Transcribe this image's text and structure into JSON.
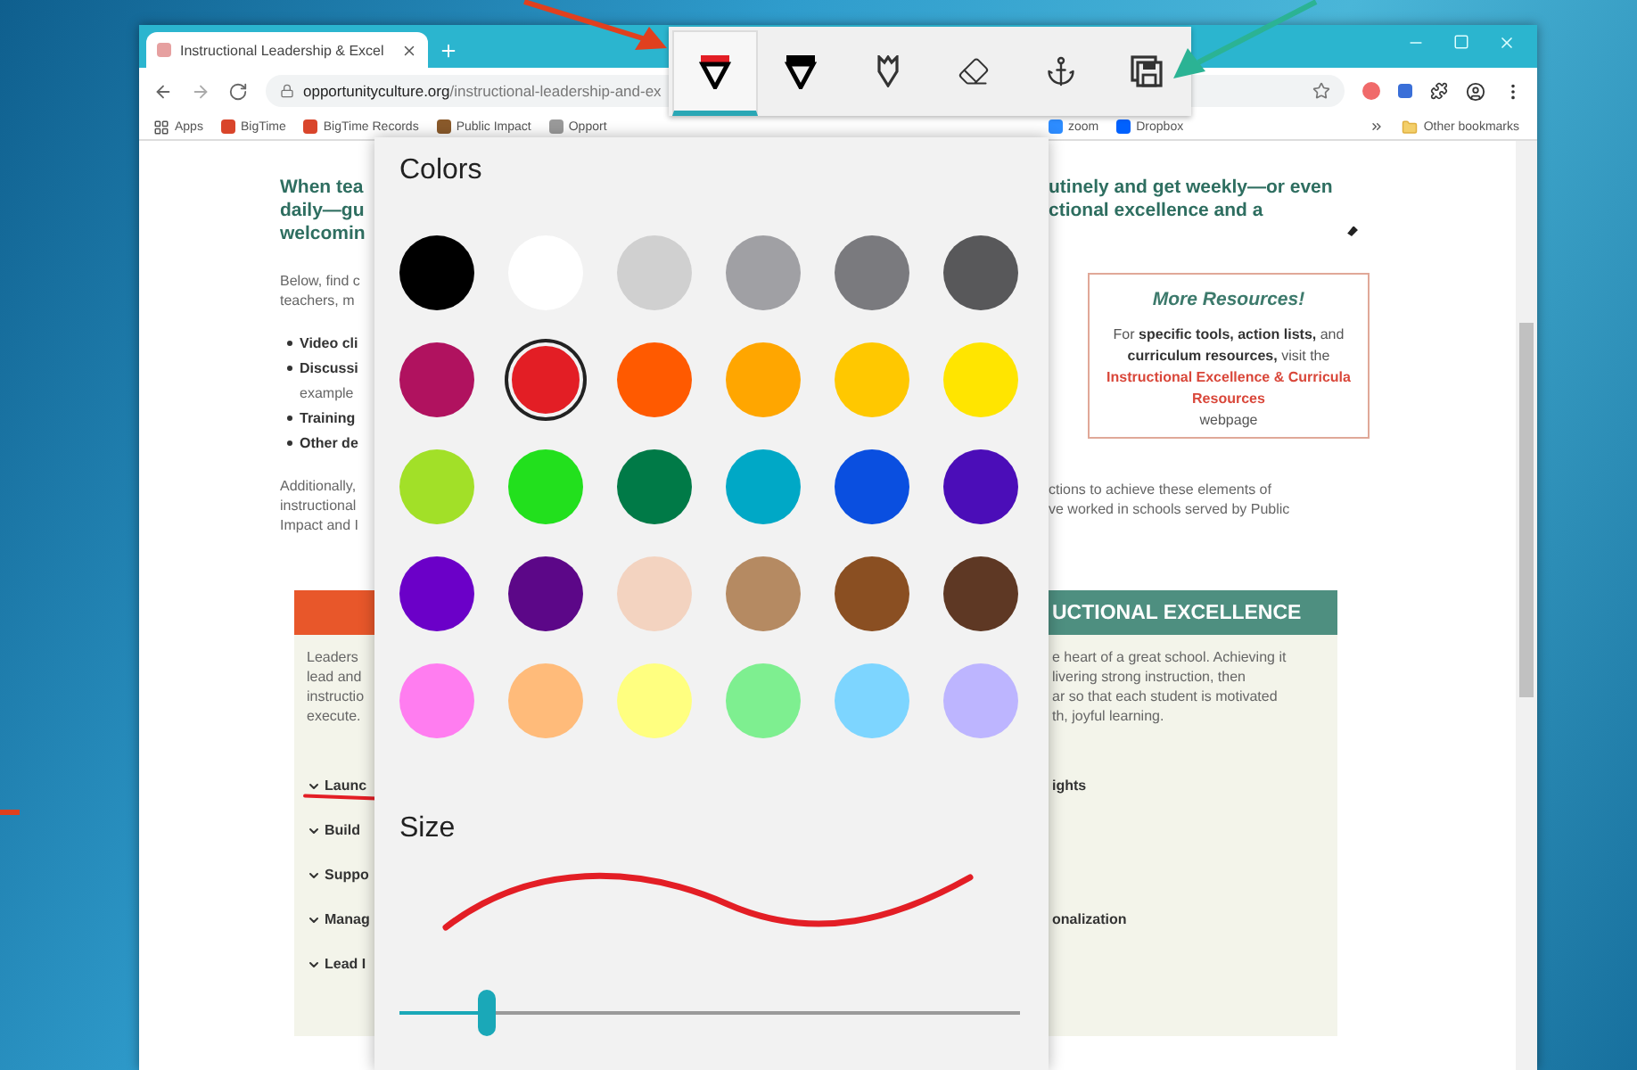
{
  "browser": {
    "tab_title": "Instructional Leadership & Excel",
    "url_domain": "opportunityculture.org",
    "url_path": "/instructional-leadership-and-ex",
    "bookmarks": [
      {
        "kind": "apps",
        "label": "Apps"
      },
      {
        "kind": "site",
        "label": "BigTime",
        "color": "#d9452b"
      },
      {
        "kind": "site",
        "label": "BigTime Records",
        "color": "#d9452b"
      },
      {
        "kind": "site",
        "label": "Public Impact",
        "color": "#8a5a2b"
      },
      {
        "kind": "site",
        "label": "Opport",
        "color": "#9a9a9a"
      }
    ],
    "bookmarks_right": [
      {
        "kind": "site",
        "label": "zoom",
        "color": "#2d8cff"
      },
      {
        "kind": "site",
        "label": "Dropbox",
        "color": "#0061fe"
      }
    ],
    "other_bookmarks": "Other bookmarks"
  },
  "page": {
    "heading_left": [
      "When tea",
      "daily—gu",
      "welcomin"
    ],
    "heading_right": [
      "utinely and get weekly—or even",
      "ctional excellence and a"
    ],
    "intro": [
      "Below, find c",
      "teachers, m"
    ],
    "bullets": [
      {
        "text": "Video cli"
      },
      {
        "text": "Discussi",
        "continuation": "example"
      },
      {
        "text": "Training"
      },
      {
        "text": "Other de"
      }
    ],
    "additional_left": [
      "Additionally,",
      "instructional",
      "Impact and I"
    ],
    "additional_right": [
      "ctions to achieve these elements of",
      "ve worked in schools served by Public"
    ],
    "resources": {
      "title": "More Resources!",
      "text": "For **specific tools, action lists,** and **curriculum resources,** visit the",
      "link": "Instructional Excellence & Curricula Resources",
      "after": "webpage"
    },
    "section": {
      "header": "UCTIONAL EXCELLENCE",
      "body_left": [
        "Leaders",
        "lead and",
        "instructio",
        "execute."
      ],
      "body_right": [
        "e heart of a great school. Achieving it",
        "livering strong instruction, then",
        "ar so that each student is motivated",
        "th, joyful learning."
      ],
      "accordion": [
        {
          "left": "Launc",
          "right": "ights",
          "inked": true
        },
        {
          "left": "Build",
          "inked": false
        },
        {
          "left": "Suppo",
          "inked": false
        },
        {
          "left": "Manag",
          "right": "onalization",
          "inked": false
        },
        {
          "left": "Lead I",
          "inked": false
        }
      ]
    }
  },
  "toolbar": {
    "tools": [
      {
        "kind": "pen",
        "color": "#e31e25",
        "selected": true
      },
      {
        "kind": "pen",
        "color": "#000000",
        "selected": false
      },
      {
        "kind": "pencil",
        "selected": false
      },
      {
        "kind": "eraser",
        "selected": false
      },
      {
        "kind": "anchor",
        "selected": false
      },
      {
        "kind": "save",
        "selected": false
      }
    ]
  },
  "flyout": {
    "title": "Colors",
    "size_label": "Size",
    "size_slider": {
      "level": 0.14
    },
    "colors": [
      {
        "color": "#000000",
        "selected": false
      },
      {
        "color": "#ffffff",
        "selected": false
      },
      {
        "color": "#d0d0d0",
        "selected": false
      },
      {
        "color": "#a0a0a4",
        "selected": false
      },
      {
        "color": "#7a7a7e",
        "selected": false
      },
      {
        "color": "#58585a",
        "selected": false
      },
      {
        "color": "#b0125f",
        "selected": false
      },
      {
        "color": "#e31e25",
        "selected": true
      },
      {
        "color": "#ff5a00",
        "selected": false
      },
      {
        "color": "#ffa600",
        "selected": false
      },
      {
        "color": "#ffc800",
        "selected": false
      },
      {
        "color": "#ffe500",
        "selected": false
      },
      {
        "color": "#a2e028",
        "selected": false
      },
      {
        "color": "#22e01d",
        "selected": false
      },
      {
        "color": "#007a47",
        "selected": false
      },
      {
        "color": "#00a8c6",
        "selected": false
      },
      {
        "color": "#0a4fe0",
        "selected": false
      },
      {
        "color": "#4b0db8",
        "selected": false
      },
      {
        "color": "#6b00c8",
        "selected": false
      },
      {
        "color": "#5c0788",
        "selected": false
      },
      {
        "color": "#f3d3c0",
        "selected": false
      },
      {
        "color": "#b58a62",
        "selected": false
      },
      {
        "color": "#8a4f22",
        "selected": false
      },
      {
        "color": "#5e3824",
        "selected": false
      },
      {
        "color": "#ff7df0",
        "selected": false
      },
      {
        "color": "#ffbb7a",
        "selected": false
      },
      {
        "color": "#ffff80",
        "selected": false
      },
      {
        "color": "#7eef90",
        "selected": false
      },
      {
        "color": "#7dd5ff",
        "selected": false
      },
      {
        "color": "#bdb5ff",
        "selected": false
      }
    ]
  }
}
